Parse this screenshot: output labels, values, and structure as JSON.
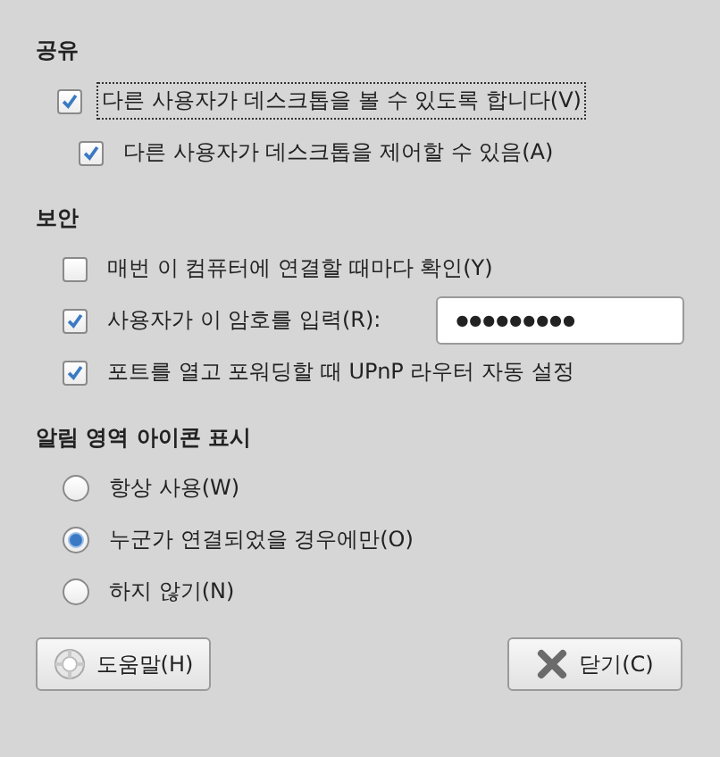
{
  "sections": [
    {
      "title": "공유",
      "items": [
        {
          "kind": "checkbox",
          "label": "다른 사용자가 데스크톱을 볼 수 있도록 합니다(V)",
          "checked": true,
          "focused": true,
          "children": [
            {
              "kind": "checkbox",
              "label": "다른 사용자가 데스크톱을 제어할 수 있음(A)",
              "checked": true,
              "focused": false
            }
          ]
        }
      ]
    },
    {
      "title": "보안",
      "items": [
        {
          "kind": "checkbox",
          "label": "매번 이 컴퓨터에 연결할 때마다 확인(Y)",
          "checked": false,
          "focused": false
        },
        {
          "kind": "password",
          "label": "사용자가 이 암호를 입력(R):",
          "checked": true,
          "focused": false,
          "value": "●●●●●●●●●"
        },
        {
          "kind": "checkbox",
          "label": "포트를 열고 포워딩할 때 UPnP 라우터 자동 설정",
          "checked": true,
          "focused": false
        }
      ]
    },
    {
      "title": "알림 영역 아이콘 표시",
      "items": [
        {
          "kind": "radio",
          "label": "항상 사용(W)",
          "selected": false
        },
        {
          "kind": "radio",
          "label": "누군가 연결되었을 경우에만(O)",
          "selected": true
        },
        {
          "kind": "radio",
          "label": "하지 않기(N)",
          "selected": false
        }
      ]
    }
  ],
  "buttons": [
    {
      "kind": "help",
      "label": "도움말(H)"
    },
    {
      "kind": "close",
      "label": "닫기(C)"
    }
  ]
}
